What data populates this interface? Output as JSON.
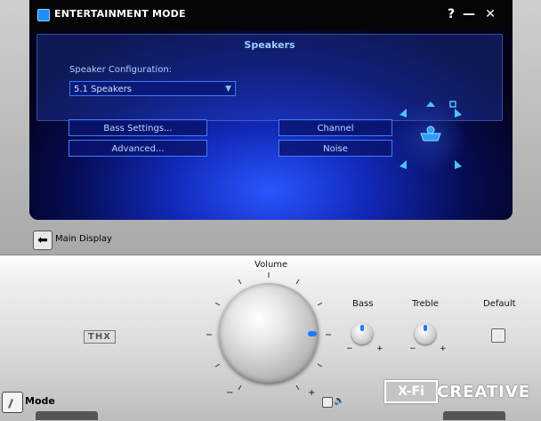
{
  "window": {
    "title": "ENTERTAINMENT MODE",
    "help": "?",
    "minimize": "—",
    "close": "✕"
  },
  "panel": {
    "section_title": "Speakers",
    "speaker_config_label": "Speaker Configuration:",
    "speaker_config_value": "5.1 Speakers",
    "buttons": {
      "bass_settings": "Bass Settings...",
      "advanced": "Advanced...",
      "channel": "Channel",
      "noise": "Noise"
    }
  },
  "main_display": {
    "label": "Main Display"
  },
  "console": {
    "volume_label": "Volume",
    "bass_label": "Bass",
    "treble_label": "Treble",
    "default_label": "Default",
    "thx_logo": "THX",
    "mode_label": "Mode",
    "brand_xfi": "X-Fi",
    "brand_creative": "CREATIVE",
    "minus": "−",
    "plus": "+"
  },
  "colors": {
    "accent": "#1a7bff",
    "panel_blue": "#1129b8",
    "button_border": "#3f7dff"
  }
}
